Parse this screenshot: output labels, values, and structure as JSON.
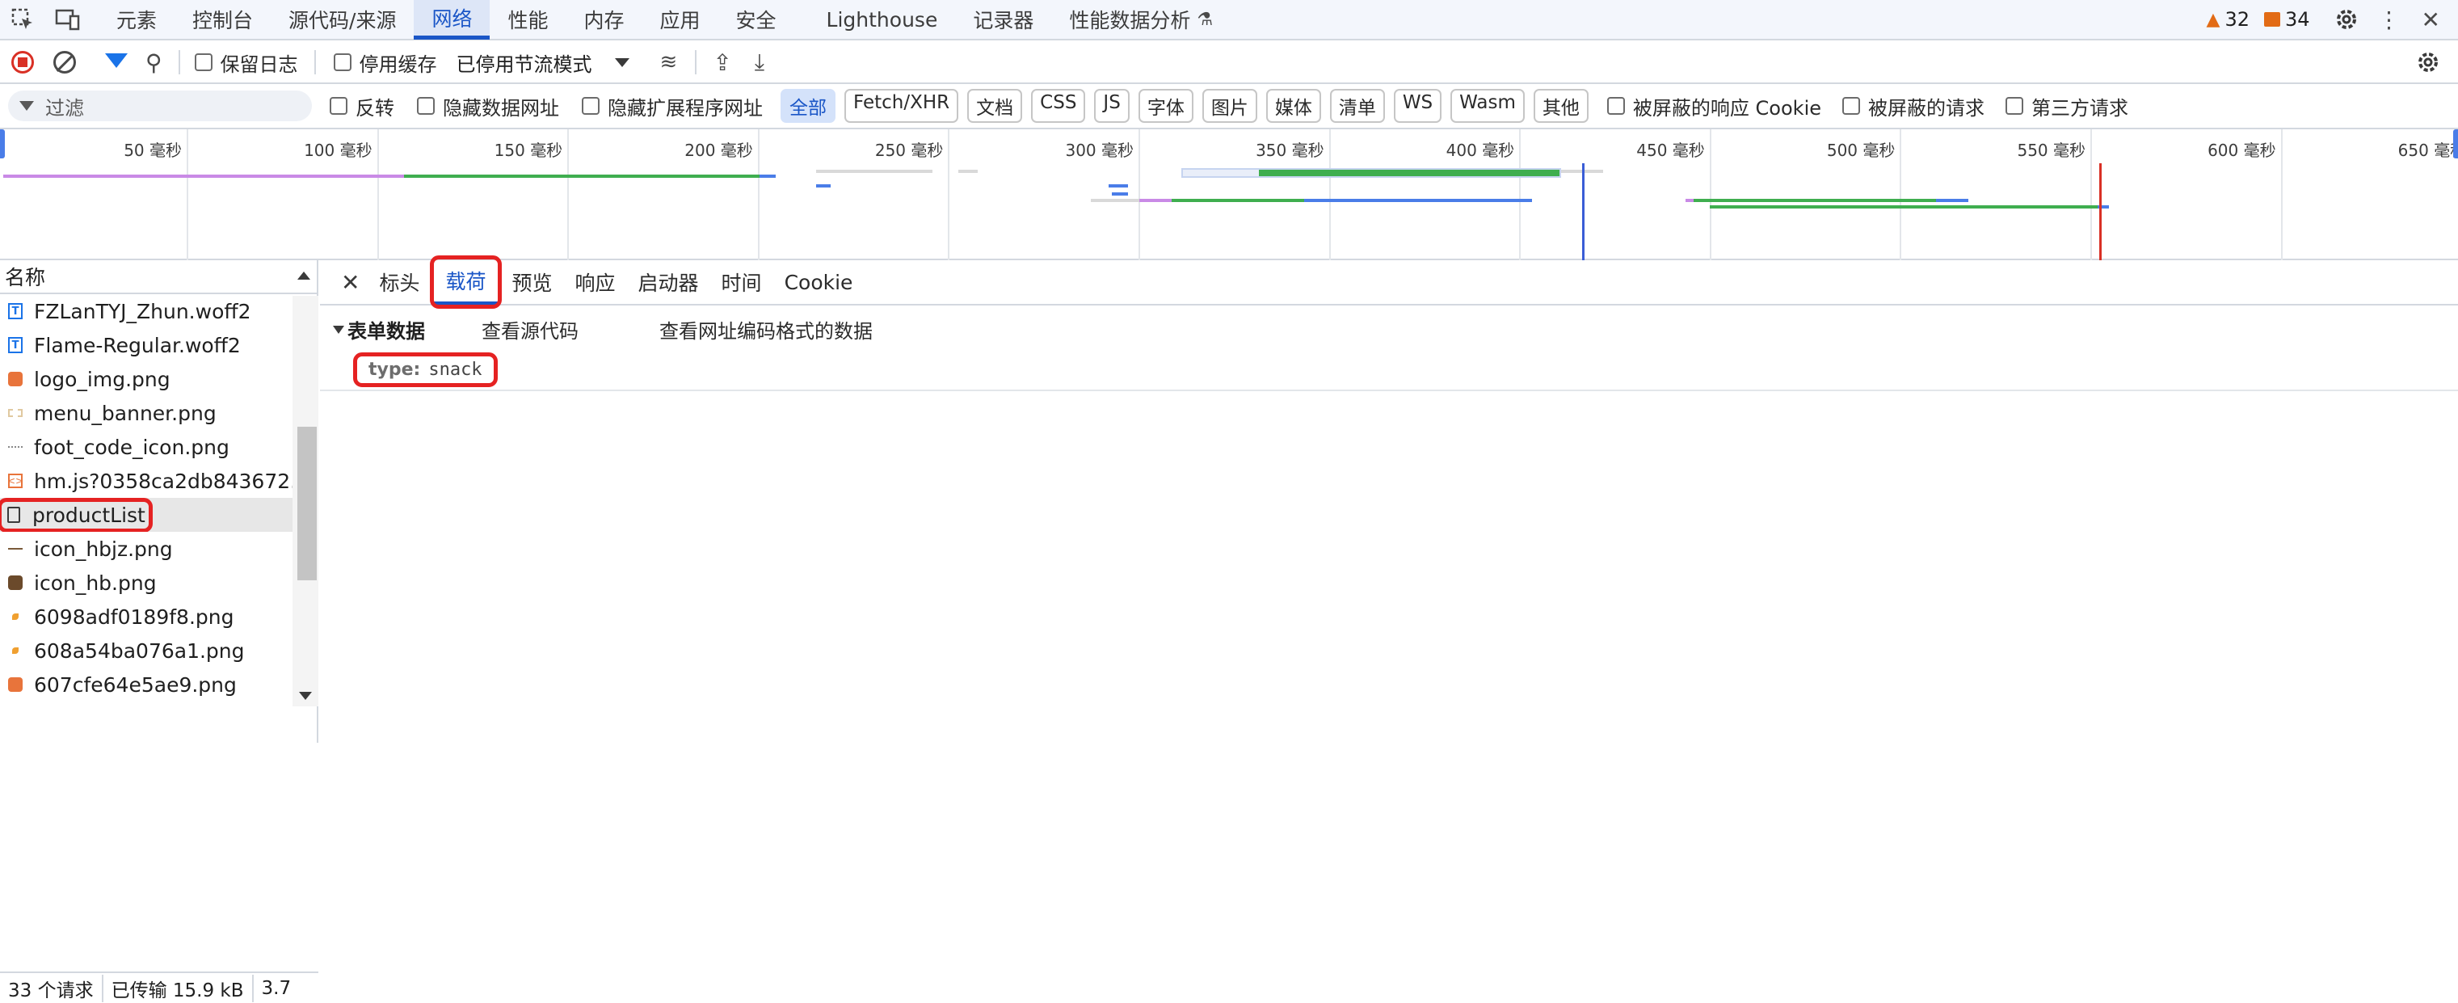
{
  "devtools_tabs": {
    "items": [
      "元素",
      "控制台",
      "源代码/来源",
      "网络",
      "性能",
      "内存",
      "应用",
      "安全",
      "Lighthouse",
      "记录器",
      "性能数据分析"
    ],
    "active": "网络",
    "warnings_count": "32",
    "issues_count": "34"
  },
  "toolbar": {
    "preserve_log": "保留日志",
    "disable_cache": "停用缓存",
    "throttle": "已停用节流模式"
  },
  "filter_bar": {
    "placeholder": "过滤",
    "invert": "反转",
    "hide_data_urls": "隐藏数据网址",
    "hide_extension_urls": "隐藏扩展程序网址",
    "types": [
      "全部",
      "Fetch/XHR",
      "文档",
      "CSS",
      "JS",
      "字体",
      "图片",
      "媒体",
      "清单",
      "WS",
      "Wasm",
      "其他"
    ],
    "active_type": "全部",
    "blocked_cookies": "被屏蔽的响应 Cookie",
    "blocked_requests": "被屏蔽的请求",
    "third_party": "第三方请求"
  },
  "overview": {
    "ticks": [
      "50 毫秒",
      "100 毫秒",
      "150 毫秒",
      "200 毫秒",
      "250 毫秒",
      "300 毫秒",
      "350 毫秒",
      "400 毫秒",
      "450 毫秒",
      "500 毫秒",
      "550 毫秒",
      "600 毫秒",
      "650 毫秒"
    ]
  },
  "requests": {
    "column_name": "名称",
    "files": [
      {
        "name": "FZLanTYJ_Zhun.woff2",
        "type": "font",
        "selected": false
      },
      {
        "name": "Flame-Regular.woff2",
        "type": "font",
        "selected": false
      },
      {
        "name": "logo_img.png",
        "type": "image-orange",
        "selected": false
      },
      {
        "name": "menu_banner.png",
        "type": "image-light",
        "selected": false
      },
      {
        "name": "foot_code_icon.png",
        "type": "image-dots",
        "selected": false
      },
      {
        "name": "hm.js?0358ca2db843672...",
        "type": "script",
        "selected": false
      },
      {
        "name": "productList",
        "type": "document",
        "selected": true
      },
      {
        "name": "icon_hbjz.png",
        "type": "image-line",
        "selected": false
      },
      {
        "name": "icon_hb.png",
        "type": "image-dark",
        "selected": false
      },
      {
        "name": "6098adf0189f8.png",
        "type": "image-small",
        "selected": false
      },
      {
        "name": "608a54ba076a1.png",
        "type": "image-small",
        "selected": false
      },
      {
        "name": "607cfe64e5ae9.png",
        "type": "image-orange",
        "selected": false
      }
    ]
  },
  "status": {
    "request_count": "33 个请求",
    "transferred": "已传输 15.9 kB",
    "resources": "3.7"
  },
  "detail": {
    "tabs": [
      "标头",
      "载荷",
      "预览",
      "响应",
      "启动器",
      "时间",
      "Cookie"
    ],
    "active_tab": "载荷",
    "form_data_title": "表单数据",
    "view_source": "查看源代码",
    "view_url_encoded": "查看网址编码格式的数据",
    "param_key": "type:",
    "param_value": "snack"
  }
}
